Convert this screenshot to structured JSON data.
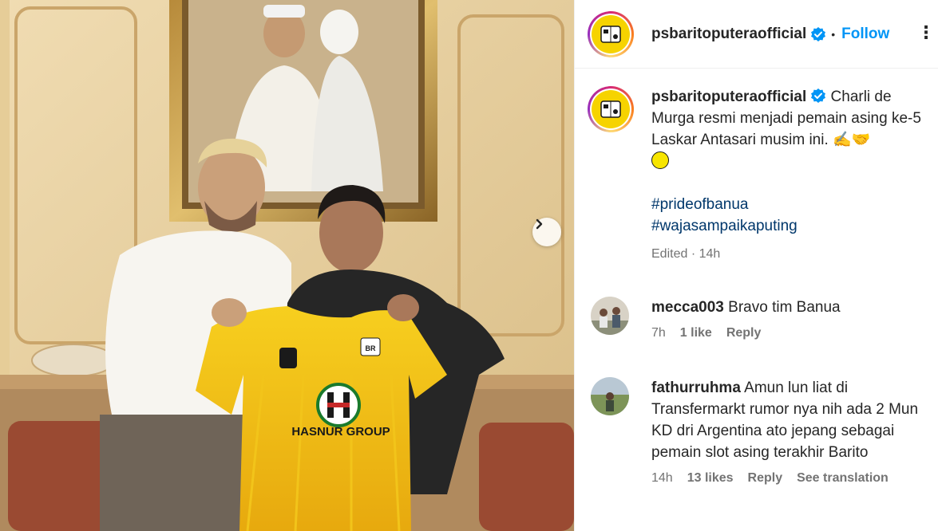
{
  "post": {
    "carousel": {
      "next_icon": "chevron-right-icon"
    },
    "photo_text": {
      "jersey_brand": "HASNUR GROUP",
      "crest_text": "BR"
    }
  },
  "header": {
    "username": "psbaritoputeraofficial",
    "separator": "•",
    "follow_label": "Follow",
    "more_label": "⋮"
  },
  "caption": {
    "username": "psbaritoputeraofficial",
    "text": "Charli de Murga resmi menjadi pemain asing ke-5 Laskar Antasari musim ini.",
    "emojis": "✍️🤝",
    "hashtags": [
      "#prideofbanua",
      "#wajasampaikaputing"
    ],
    "edited_label": "Edited",
    "time": "14h"
  },
  "comments": [
    {
      "username": "mecca003",
      "text": "Bravo tim Banua",
      "time": "7h",
      "likes": "1 like",
      "reply_label": "Reply"
    },
    {
      "username": "fathurruhma",
      "text": "Amun lun liat di Transfermarkt rumor nya nih ada 2 Mun KD dri Argentina ato jepang sebagai pemain slot asing terakhir Barito",
      "time": "14h",
      "likes": "13 likes",
      "reply_label": "Reply",
      "translate_label": "See translation"
    }
  ],
  "colors": {
    "link_blue": "#0095f6",
    "hashtag": "#00376b",
    "muted": "#737373",
    "verified": "#0095f6",
    "club_yellow": "#f6d300"
  }
}
